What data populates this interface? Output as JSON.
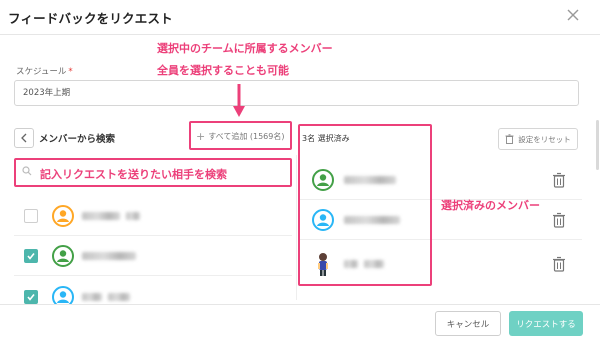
{
  "modal": {
    "title": "フィードバックをリクエスト"
  },
  "schedule": {
    "label": "スケジュール",
    "required_mark": "*",
    "value": "2023年上期"
  },
  "search_panel": {
    "title": "メンバーから検索",
    "add_all_label": "すべて追加 (1569名)",
    "search_placeholder": "",
    "members": [
      {
        "checked": false,
        "avatar": "green-person-icon"
      },
      {
        "checked": true,
        "avatar": "green-person-icon"
      },
      {
        "checked": true,
        "avatar": "blue-person-icon"
      }
    ]
  },
  "selected_panel": {
    "count_label": "3名 選択済み",
    "reset_label": "設定をリセット",
    "members": [
      {
        "avatar": "green-person-icon"
      },
      {
        "avatar": "blue-person-icon"
      },
      {
        "avatar": "character-photo"
      }
    ]
  },
  "footer": {
    "cancel_label": "キャンセル",
    "submit_label": "リクエストする"
  },
  "annotations": {
    "team_note_line1": "選択中のチームに所属するメンバー",
    "team_note_line2": "全員を選択することも可能",
    "search_note": "記入リクエストを送りたい相手を検索",
    "selected_note": "選択済みのメンバー"
  },
  "colors": {
    "accent": "#6fd1c4",
    "checkbox": "#4db6ac",
    "annotation": "#ec407a",
    "avatar_green": "#43a047",
    "avatar_blue": "#29b6f6"
  }
}
